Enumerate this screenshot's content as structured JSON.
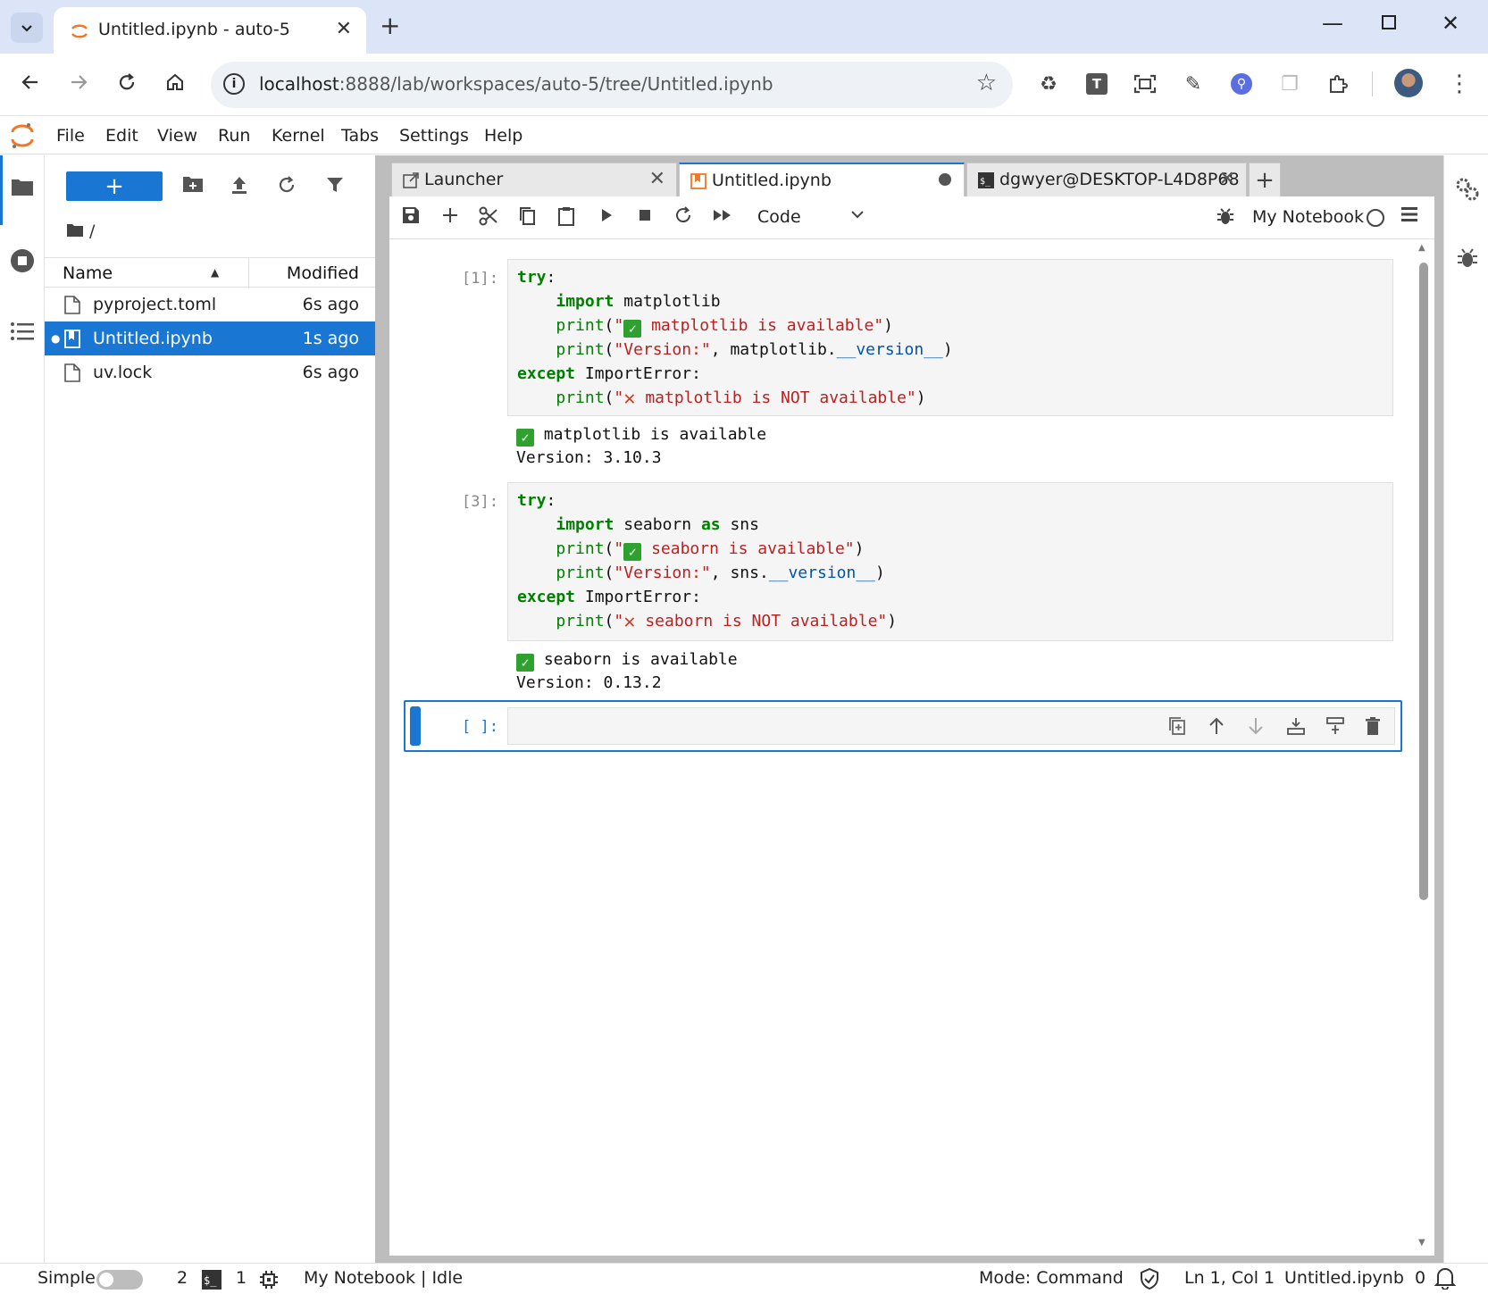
{
  "browser": {
    "tab_title": "Untitled.ipynb - auto-5",
    "url_host": "localhost",
    "url_rest": ":8888/lab/workspaces/auto-5/tree/Untitled.ipynb",
    "extension_letter": "T"
  },
  "menubar": {
    "items": [
      "File",
      "Edit",
      "View",
      "Run",
      "Kernel",
      "Tabs",
      "Settings",
      "Help"
    ]
  },
  "filebrowser": {
    "new_label": "+",
    "breadcrumb": "/",
    "col_name": "Name",
    "col_modified": "Modified",
    "files": [
      {
        "name": "pyproject.toml",
        "modified": "6s ago",
        "type": "file",
        "selected": false
      },
      {
        "name": "Untitled.ipynb",
        "modified": "1s ago",
        "type": "notebook",
        "selected": true
      },
      {
        "name": "uv.lock",
        "modified": "6s ago",
        "type": "file",
        "selected": false
      }
    ]
  },
  "doc_tabs": [
    {
      "label": "Launcher"
    },
    {
      "label": "Untitled.ipynb"
    },
    {
      "label": "dgwyer@DESKTOP-L4D8P68"
    }
  ],
  "notebook": {
    "cell_type": "Code",
    "kernel_name": "My Notebook",
    "cells": [
      {
        "prompt": "[1]:",
        "output": [
          "matplotlib is available",
          "Version: 3.10.3"
        ]
      },
      {
        "prompt": "[3]:",
        "output": [
          "seaborn is available",
          "Version: 0.13.2"
        ]
      },
      {
        "prompt": "[ ]:"
      }
    ]
  },
  "statusbar": {
    "mode_label": "Simple",
    "terminals": "2",
    "kernels": "1",
    "kernel_state": "My Notebook | Idle",
    "mode": "Mode: Command",
    "cursor": "Ln 1, Col 1",
    "file": "Untitled.ipynb",
    "notifications": "0"
  },
  "colors": {
    "accent": "#1976d2",
    "keyword": "#008000",
    "string": "#ba2121"
  }
}
